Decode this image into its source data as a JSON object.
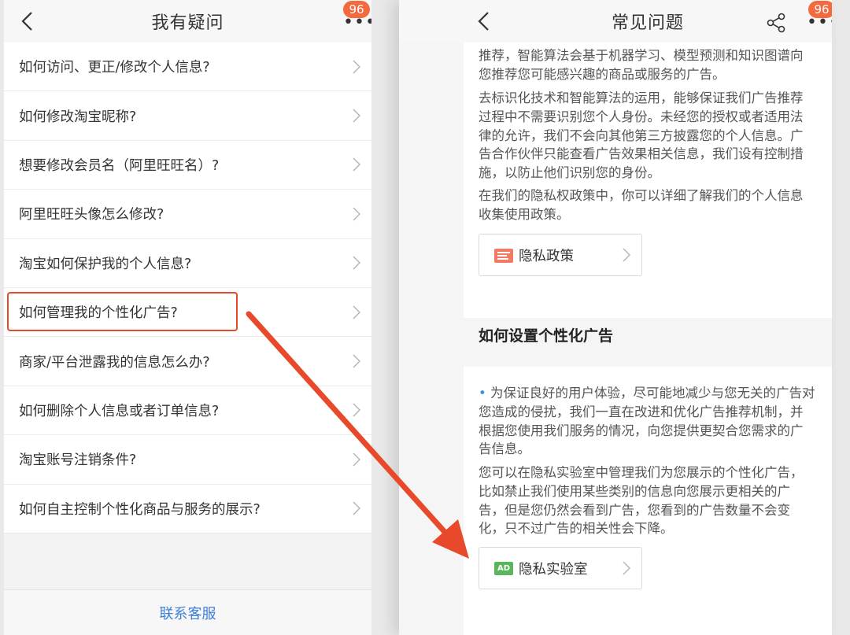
{
  "left": {
    "title": "我有疑问",
    "badge": "96",
    "questions": [
      "如何访问、更正/修改个人信息?",
      "如何修改淘宝昵称?",
      "想要修改会员名（阿里旺旺名）?",
      "阿里旺旺头像怎么修改?",
      "淘宝如何保护我的个人信息?",
      "如何管理我的个性化广告?",
      "商家/平台泄露我的信息怎么办?",
      "如何删除个人信息或者订单信息?",
      "淘宝账号注销条件?",
      "如何自主控制个性化商品与服务的展示?"
    ],
    "contact": "联系客服"
  },
  "right": {
    "title": "常见问题",
    "badge": "96",
    "para1": "推荐，智能算法会基于机器学习、模型预测和知识图谱向您推荐您可能感兴趣的商品或服务的广告。",
    "para2": "去标识化技术和智能算法的运用，能够保证我们广告推荐过程中不需要识别您个人身份。未经您的授权或者适用法律的允许，我们不会向其他第三方披露您的个人信息。广告合作伙伴只能查看广告效果相关信息，我们设有控制措施，以防止他们识别您的身份。",
    "para3": "在我们的隐私权政策中，你可以详细了解我们的个人信息收集使用政策。",
    "policy_button": "隐私政策",
    "section_title": "如何设置个性化广告",
    "bullet": "•",
    "para4": "为保证良好的用户体验，尽可能地减少与您无关的广告对您造成的侵扰，我们一直在改进和优化广告推荐机制，并根据您使用我们服务的情况，向您提供更契合您需求的广告信息。",
    "para5": "您可以在隐私实验室中管理我们为您展示的个性化广告，比如禁止我们使用某些类别的信息向您展示更相关的广告，但是您仍然会看到广告，您看到的广告数量不会变化，只不过广告的相关性会下降。",
    "lab_button": "隐私实验室",
    "ad_icon_text": "AD"
  },
  "colors": {
    "accent": "#e8492a",
    "badge": "#f26a3e",
    "link": "#3d7fd6",
    "ad": "#5bb55a"
  },
  "icons": [
    "back-icon",
    "more-icon",
    "share-icon",
    "chevron-right-icon",
    "policy-icon",
    "ad-icon"
  ]
}
